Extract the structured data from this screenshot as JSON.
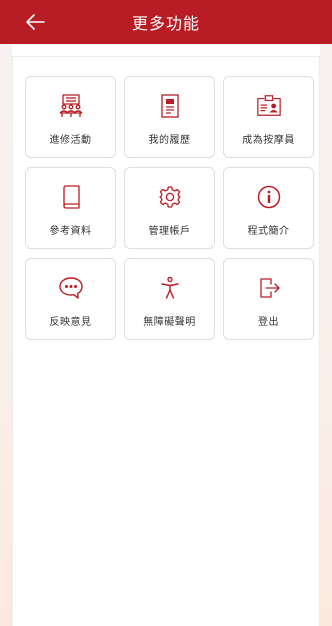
{
  "header": {
    "title": "更多功能",
    "back_icon": "arrow-left-icon",
    "background": "#b81c24"
  },
  "menu": {
    "accent_color": "#b81c24",
    "items": [
      {
        "label": "進修活動",
        "icon": "training-audience-icon"
      },
      {
        "label": "我的履歷",
        "icon": "document-icon"
      },
      {
        "label": "成為按摩員",
        "icon": "id-card-icon"
      },
      {
        "label": "參考資料",
        "icon": "book-icon"
      },
      {
        "label": "管理帳戶",
        "icon": "gear-icon"
      },
      {
        "label": "程式簡介",
        "icon": "info-icon"
      },
      {
        "label": "反映意見",
        "icon": "chat-bubble-icon"
      },
      {
        "label": "無障礙聲明",
        "icon": "accessibility-icon"
      },
      {
        "label": "登出",
        "icon": "logout-icon"
      }
    ]
  }
}
